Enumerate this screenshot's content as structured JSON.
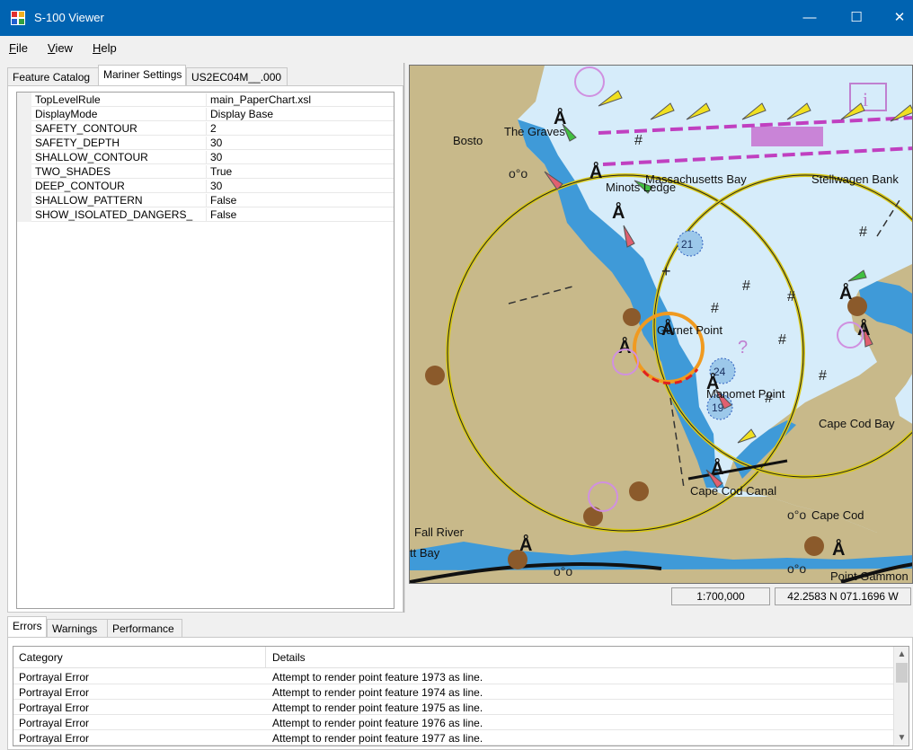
{
  "window": {
    "title": "S-100 Viewer",
    "controls": {
      "minimize": "—",
      "maximize": "☐",
      "close": "✕"
    }
  },
  "menu": {
    "file": {
      "accel": "F",
      "rest": "ile"
    },
    "view": {
      "accel": "V",
      "rest": "iew"
    },
    "help": {
      "accel": "H",
      "rest": "elp"
    }
  },
  "left_tabs": [
    "Feature Catalog",
    "Mariner Settings",
    "US2EC04M__.000"
  ],
  "active_left_tab": "Mariner Settings",
  "mariner_settings": [
    {
      "name": "TopLevelRule",
      "value": "main_PaperChart.xsl"
    },
    {
      "name": "DisplayMode",
      "value": "Display Base"
    },
    {
      "name": "SAFETY_CONTOUR",
      "value": "2"
    },
    {
      "name": "SAFETY_DEPTH",
      "value": "30"
    },
    {
      "name": "SHALLOW_CONTOUR",
      "value": "30"
    },
    {
      "name": "TWO_SHADES",
      "value": "True"
    },
    {
      "name": "DEEP_CONTOUR",
      "value": "30"
    },
    {
      "name": "SHALLOW_PATTERN",
      "value": "False"
    },
    {
      "name": "SHOW_ISOLATED_DANGERS_",
      "value": "False"
    }
  ],
  "map": {
    "labels": {
      "boston": "Bosto",
      "graves": "The Graves",
      "mass_bay": "Massachusetts Bay",
      "stellwagen": "Stellwagen Bank",
      "minots": "Minots Ledge",
      "gurnet": "Gurnet Point",
      "manomet": "Manomet Point",
      "cape_cod_bay": "Cape Cod Bay",
      "canal": "Cape Cod Canal",
      "cape_cod": "Cape Cod",
      "fall_river": "Fall River",
      "bay": "tt Bay",
      "gammon": "Point Gammon"
    },
    "soundings": {
      "s1": "21",
      "s2": "24",
      "s3": "19"
    },
    "colors": {
      "land": "#c8b98a",
      "deep_water": "#d6ecfa",
      "shallow_water": "#3f9ad8",
      "magenta": "#c040c0",
      "light_yellow": "#f0e020",
      "light_red": "#e06070",
      "light_green": "#40c040"
    }
  },
  "status": {
    "scale": "1:700,000",
    "position": "42.2583 N 071.1696 W"
  },
  "bottom_tabs": [
    "Errors",
    "Warnings",
    "Performance"
  ],
  "active_bottom_tab": "Errors",
  "errors": {
    "columns": {
      "category": "Category",
      "details": "Details"
    },
    "rows": [
      {
        "category": "Portrayal Error",
        "details": "Attempt to render point feature 1973 as line."
      },
      {
        "category": "Portrayal Error",
        "details": "Attempt to render point feature 1974 as line."
      },
      {
        "category": "Portrayal Error",
        "details": "Attempt to render point feature 1975 as line."
      },
      {
        "category": "Portrayal Error",
        "details": "Attempt to render point feature 1976 as line."
      },
      {
        "category": "Portrayal Error",
        "details": "Attempt to render point feature 1977 as line."
      }
    ]
  }
}
